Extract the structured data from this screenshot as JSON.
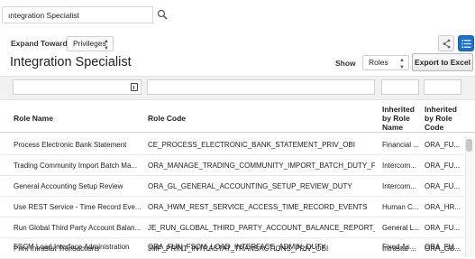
{
  "search": {
    "value": "ıntegration Specialist"
  },
  "toolbar": {
    "expand_toward_label": "Expand Toward",
    "expand_toward_value": "Privileges",
    "show_label": "Show",
    "show_value": "Roles",
    "export_label": "Export to Excel"
  },
  "page": {
    "title": "Integration Specialist"
  },
  "table": {
    "headers": {
      "role_name": "Role Name",
      "role_code": "Role Code",
      "inherited_by_role_name": "Inherited by Role Name",
      "inherited_by_role_code": "Inherited by Role Code"
    },
    "rows": [
      {
        "name": "Process Electronic Bank Statement",
        "code": "CE_PROCESS_ELECTRONIC_BANK_STATEMENT_PRIV_OBI",
        "inherited_name": "Financial ...",
        "inherited_code": "ORA_FU..."
      },
      {
        "name": "Trading Community Import Batch Ma...",
        "code": "ORA_MANAGE_TRADING_COMMUNITY_IMPORT_BATCH_DUTY_F...",
        "inherited_name": "Intercom...",
        "inherited_code": "ORA_FU..."
      },
      {
        "name": "General Accounting Setup Review",
        "code": "ORA_GL_GENERAL_ACCOUNTING_SETUP_REVIEW_DUTY",
        "inherited_name": "Intercom...",
        "inherited_code": "ORA_FU..."
      },
      {
        "name": "Use REST Service - Time Record Eve...",
        "code": "ORA_HWM_REST_SERVICE_ACCESS_TIME_RECORD_EVENTS",
        "inherited_name": "Human C...",
        "inherited_code": "ORA_HR..."
      },
      {
        "name": "Run Global Third Party Account Balan...",
        "code": "JE_RUN_GLOBAL_THIRD_PARTY_ACCOUNT_BALANCE_REPORT_...",
        "inherited_name": "General L...",
        "inherited_code": "ORA_FU..."
      },
      {
        "name": "Print Intrastat Transactions",
        "code": "JMF_PRINT_INTRASTAT_TRANSACTIONS_PRIV_OBI",
        "inherited_name": "Intrastat ...",
        "inherited_code": "ORA_GB..."
      },
      {
        "name": "FSCM Load Interface Administration",
        "code": "ORA_FUN_FSCM_LOAD_INTERFACE_ADMIN_DUTY",
        "inherited_name": "Fixed As...",
        "inherited_code": "ORA_FU..."
      }
    ]
  },
  "colors": {
    "accent": "#1e6fc8",
    "filter_band": "#f1f1f1"
  },
  "icons": [
    "search-icon",
    "calendar-icon",
    "hierarchy-view-icon",
    "list-view-icon"
  ]
}
